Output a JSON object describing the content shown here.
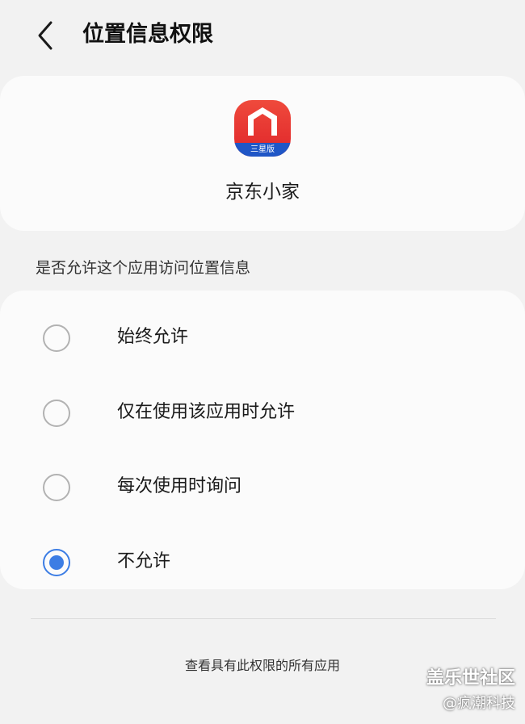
{
  "header": {
    "back_icon": "chevron-left-icon",
    "title": "位置信息权限"
  },
  "app": {
    "icon": "jd-home-app-icon",
    "icon_badge": "三星版",
    "name": "京东小家",
    "colors": {
      "icon_red": "#e0262a",
      "badge_blue": "#1f56c6"
    }
  },
  "question": "是否允许这个应用访问位置信息",
  "options": [
    {
      "label": "始终允许",
      "selected": false
    },
    {
      "label": "仅在使用该应用时允许",
      "selected": false
    },
    {
      "label": "每次使用时询问",
      "selected": false
    },
    {
      "label": "不允许",
      "selected": true
    }
  ],
  "footer": {
    "view_all_label": "查看具有此权限的所有应用"
  },
  "watermark": {
    "line1": "盖乐世社区",
    "line2": "@疯潮科技"
  },
  "colors": {
    "accent": "#3c7de4",
    "background": "#f2f2f2",
    "card": "#fbfbfb"
  }
}
